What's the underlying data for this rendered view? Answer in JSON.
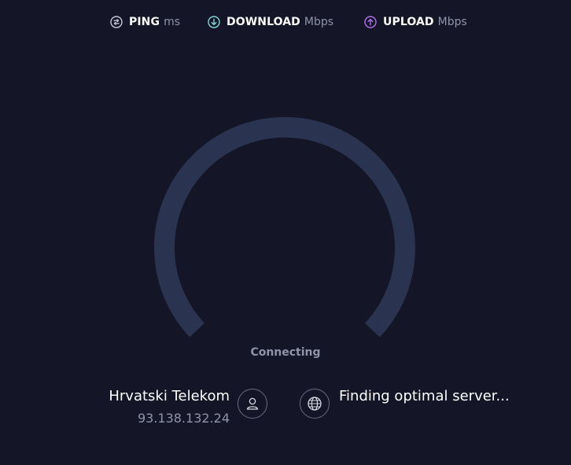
{
  "metrics": {
    "ping": {
      "label": "PING",
      "unit": "ms",
      "icon": "ping-icon",
      "color": "#c5c7d6"
    },
    "download": {
      "label": "DOWNLOAD",
      "unit": "Mbps",
      "icon": "download-arrow-icon",
      "color": "#7fd9d4"
    },
    "upload": {
      "label": "UPLOAD",
      "unit": "Mbps",
      "icon": "upload-arrow-icon",
      "color": "#b46ef0"
    }
  },
  "gauge": {
    "track_color": "#2a3350",
    "progress": 0
  },
  "status": "Connecting",
  "connection": {
    "isp_name": "Hrvatski Telekom",
    "ip": "93.138.132.24",
    "user_icon": "user-icon",
    "globe_icon": "globe-icon",
    "server_status": "Finding optimal server..."
  },
  "colors": {
    "background": "#141526",
    "muted_text": "#9193a8"
  }
}
